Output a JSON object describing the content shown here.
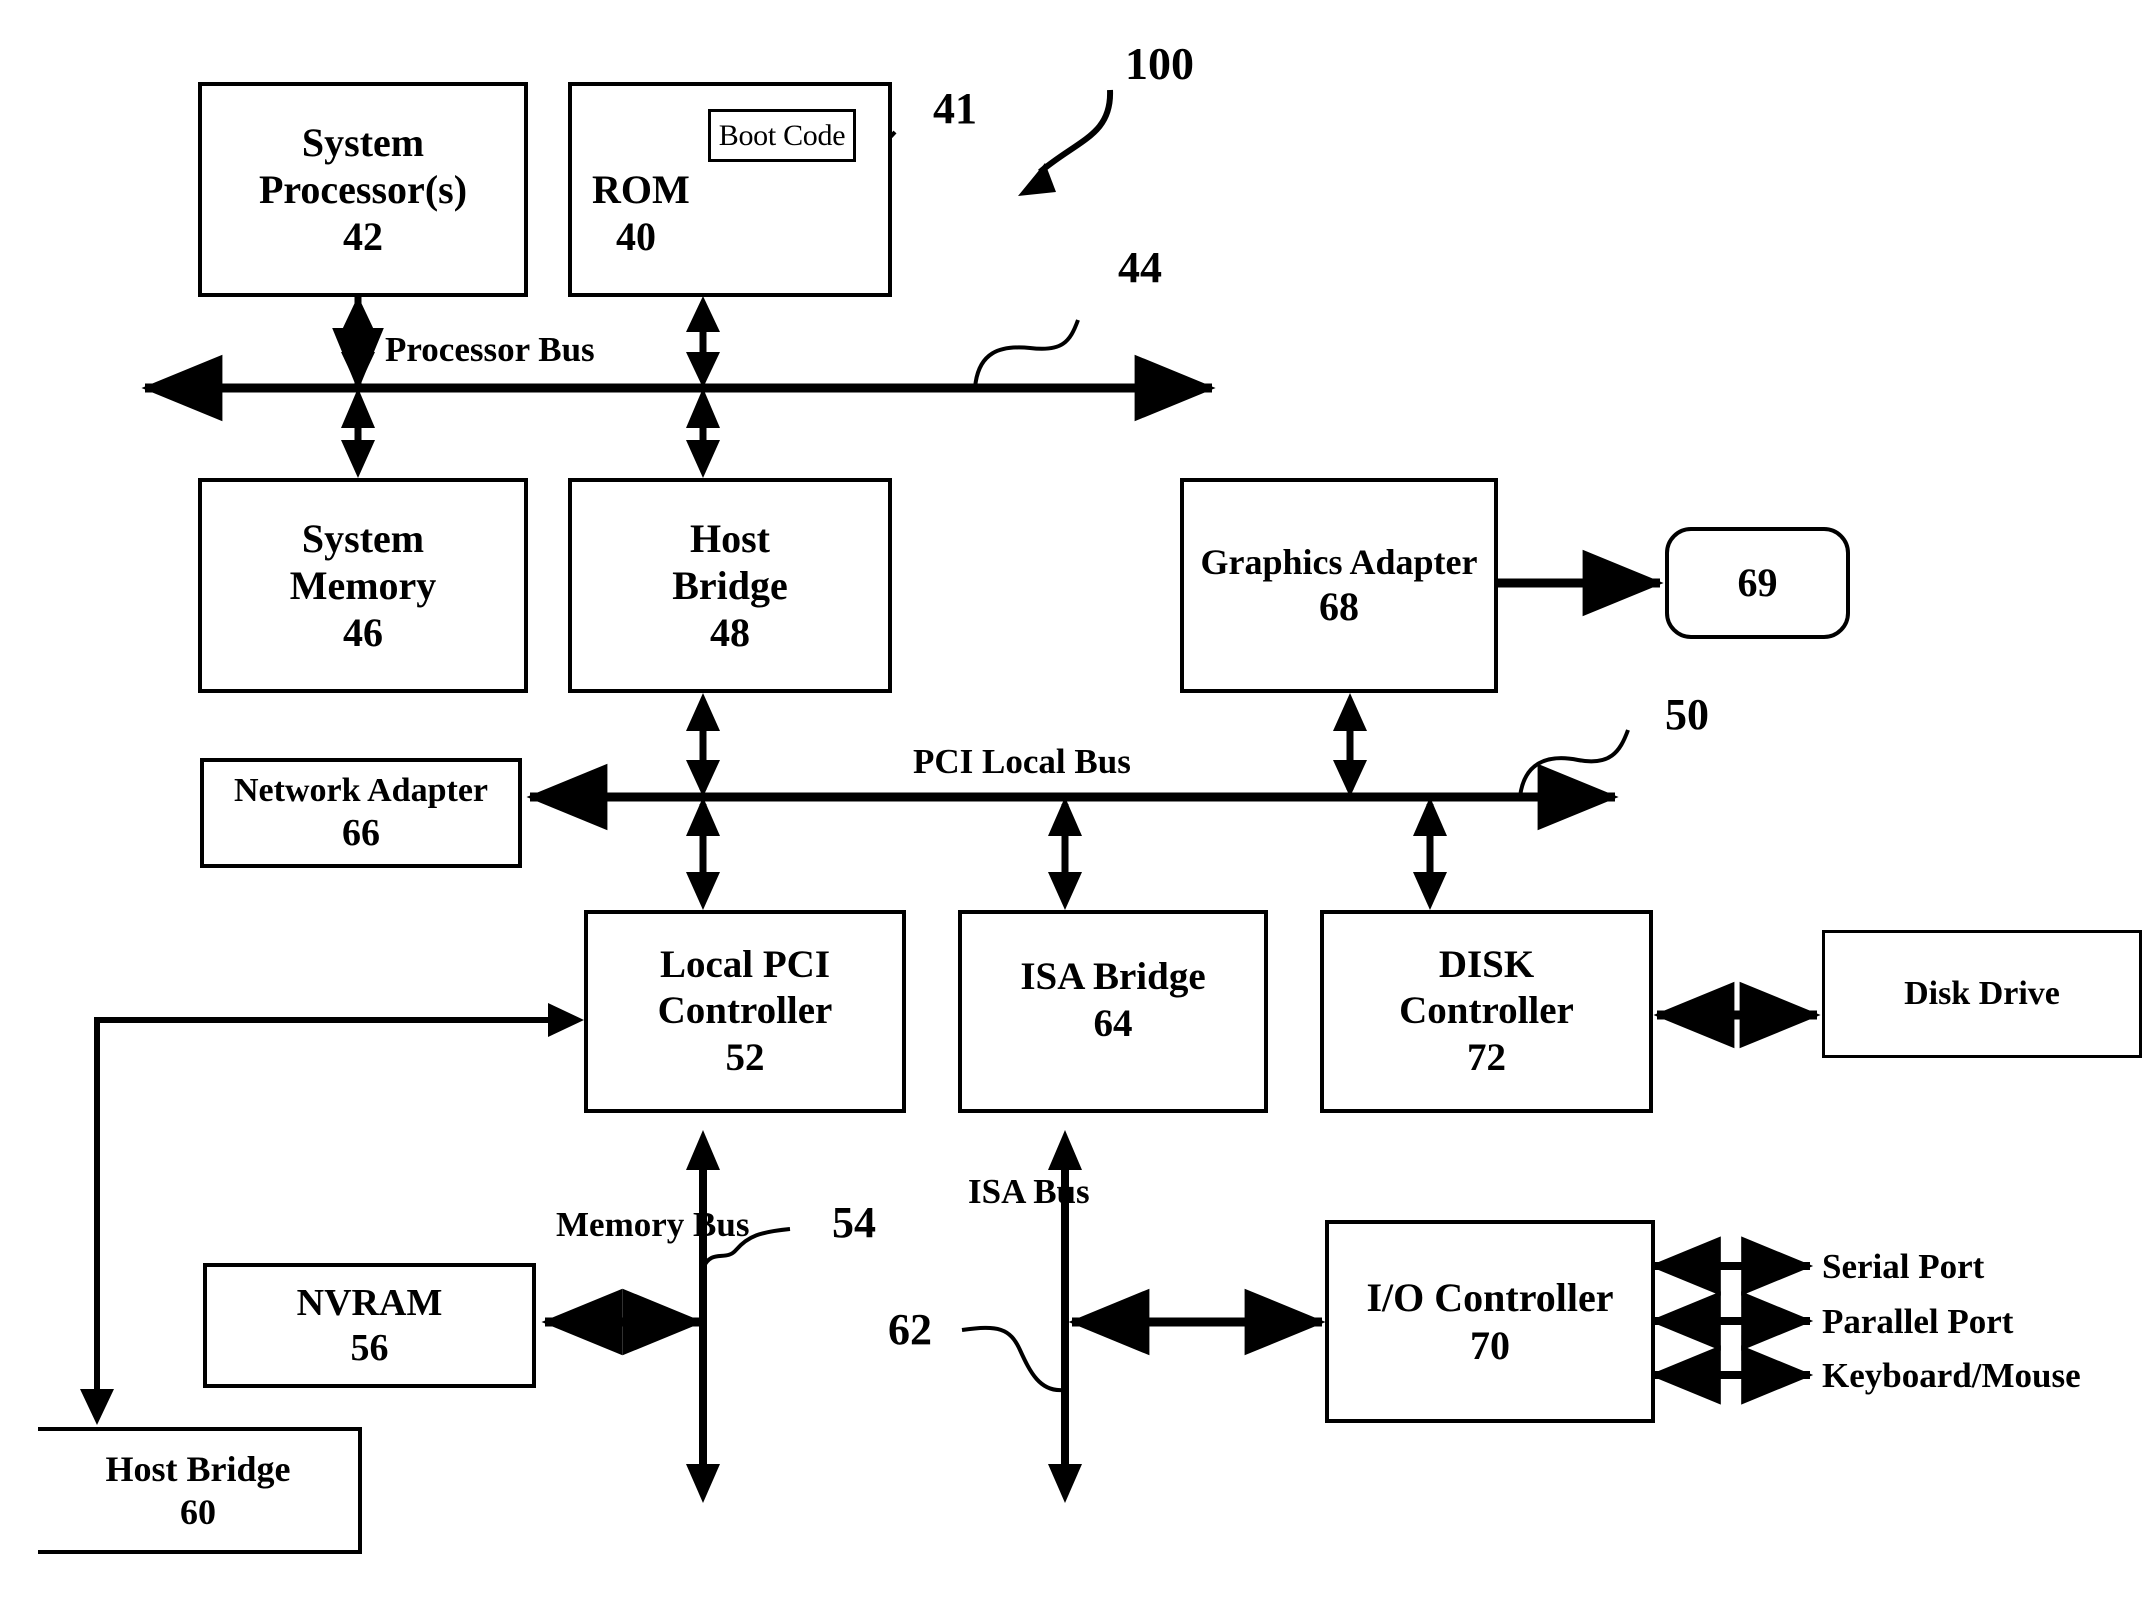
{
  "figure": {
    "type": "computer-system-block-diagram",
    "reference_numeral": "100"
  },
  "nodes": {
    "system_processor": {
      "title_line1": "System",
      "title_line2": "Processor(s)",
      "ref": "42"
    },
    "rom": {
      "title_line1": "ROM",
      "ref": "40"
    },
    "boot_code": {
      "label": "Boot Code",
      "ref": "41"
    },
    "system_memory": {
      "title_line1": "System",
      "title_line2": "Memory",
      "ref": "46"
    },
    "host_bridge_48": {
      "title_line1": "Host",
      "title_line2": "Bridge",
      "ref": "48"
    },
    "graphics_adapter": {
      "title_line1": "Graphics Adapter",
      "ref": "68"
    },
    "display": {
      "ref": "69"
    },
    "network_adapter": {
      "title_line1": "Network Adapter",
      "ref": "66"
    },
    "local_pci_controller": {
      "title_line1": "Local PCI",
      "title_line2": "Controller",
      "ref": "52"
    },
    "isa_bridge": {
      "title_line1": "ISA Bridge",
      "ref": "64"
    },
    "disk_controller": {
      "title_line1": "DISK",
      "title_line2": "Controller",
      "ref": "72"
    },
    "disk_drive": {
      "title_line1": "Disk Drive"
    },
    "nvram": {
      "title_line1": "NVRAM",
      "ref": "56"
    },
    "host_bridge_60": {
      "title_line1": "Host Bridge",
      "ref": "60"
    },
    "io_controller": {
      "title_line1": "I/O Controller",
      "ref": "70"
    }
  },
  "buses": {
    "processor_bus": {
      "label": "Processor Bus",
      "ref": "44"
    },
    "pci_local_bus": {
      "label": "PCI Local Bus",
      "ref": "50"
    },
    "memory_bus": {
      "label_line1": "Memory",
      "label_line2": "Bus",
      "ref": "54"
    },
    "isa_bus": {
      "label_line1": "ISA",
      "label_line2": "Bus",
      "ref": "62"
    }
  },
  "ports": [
    {
      "label": "Serial Port"
    },
    {
      "label": "Parallel Port"
    },
    {
      "label": "Keyboard/Mouse"
    }
  ],
  "colors": {
    "line": "#000000",
    "background": "#ffffff"
  }
}
